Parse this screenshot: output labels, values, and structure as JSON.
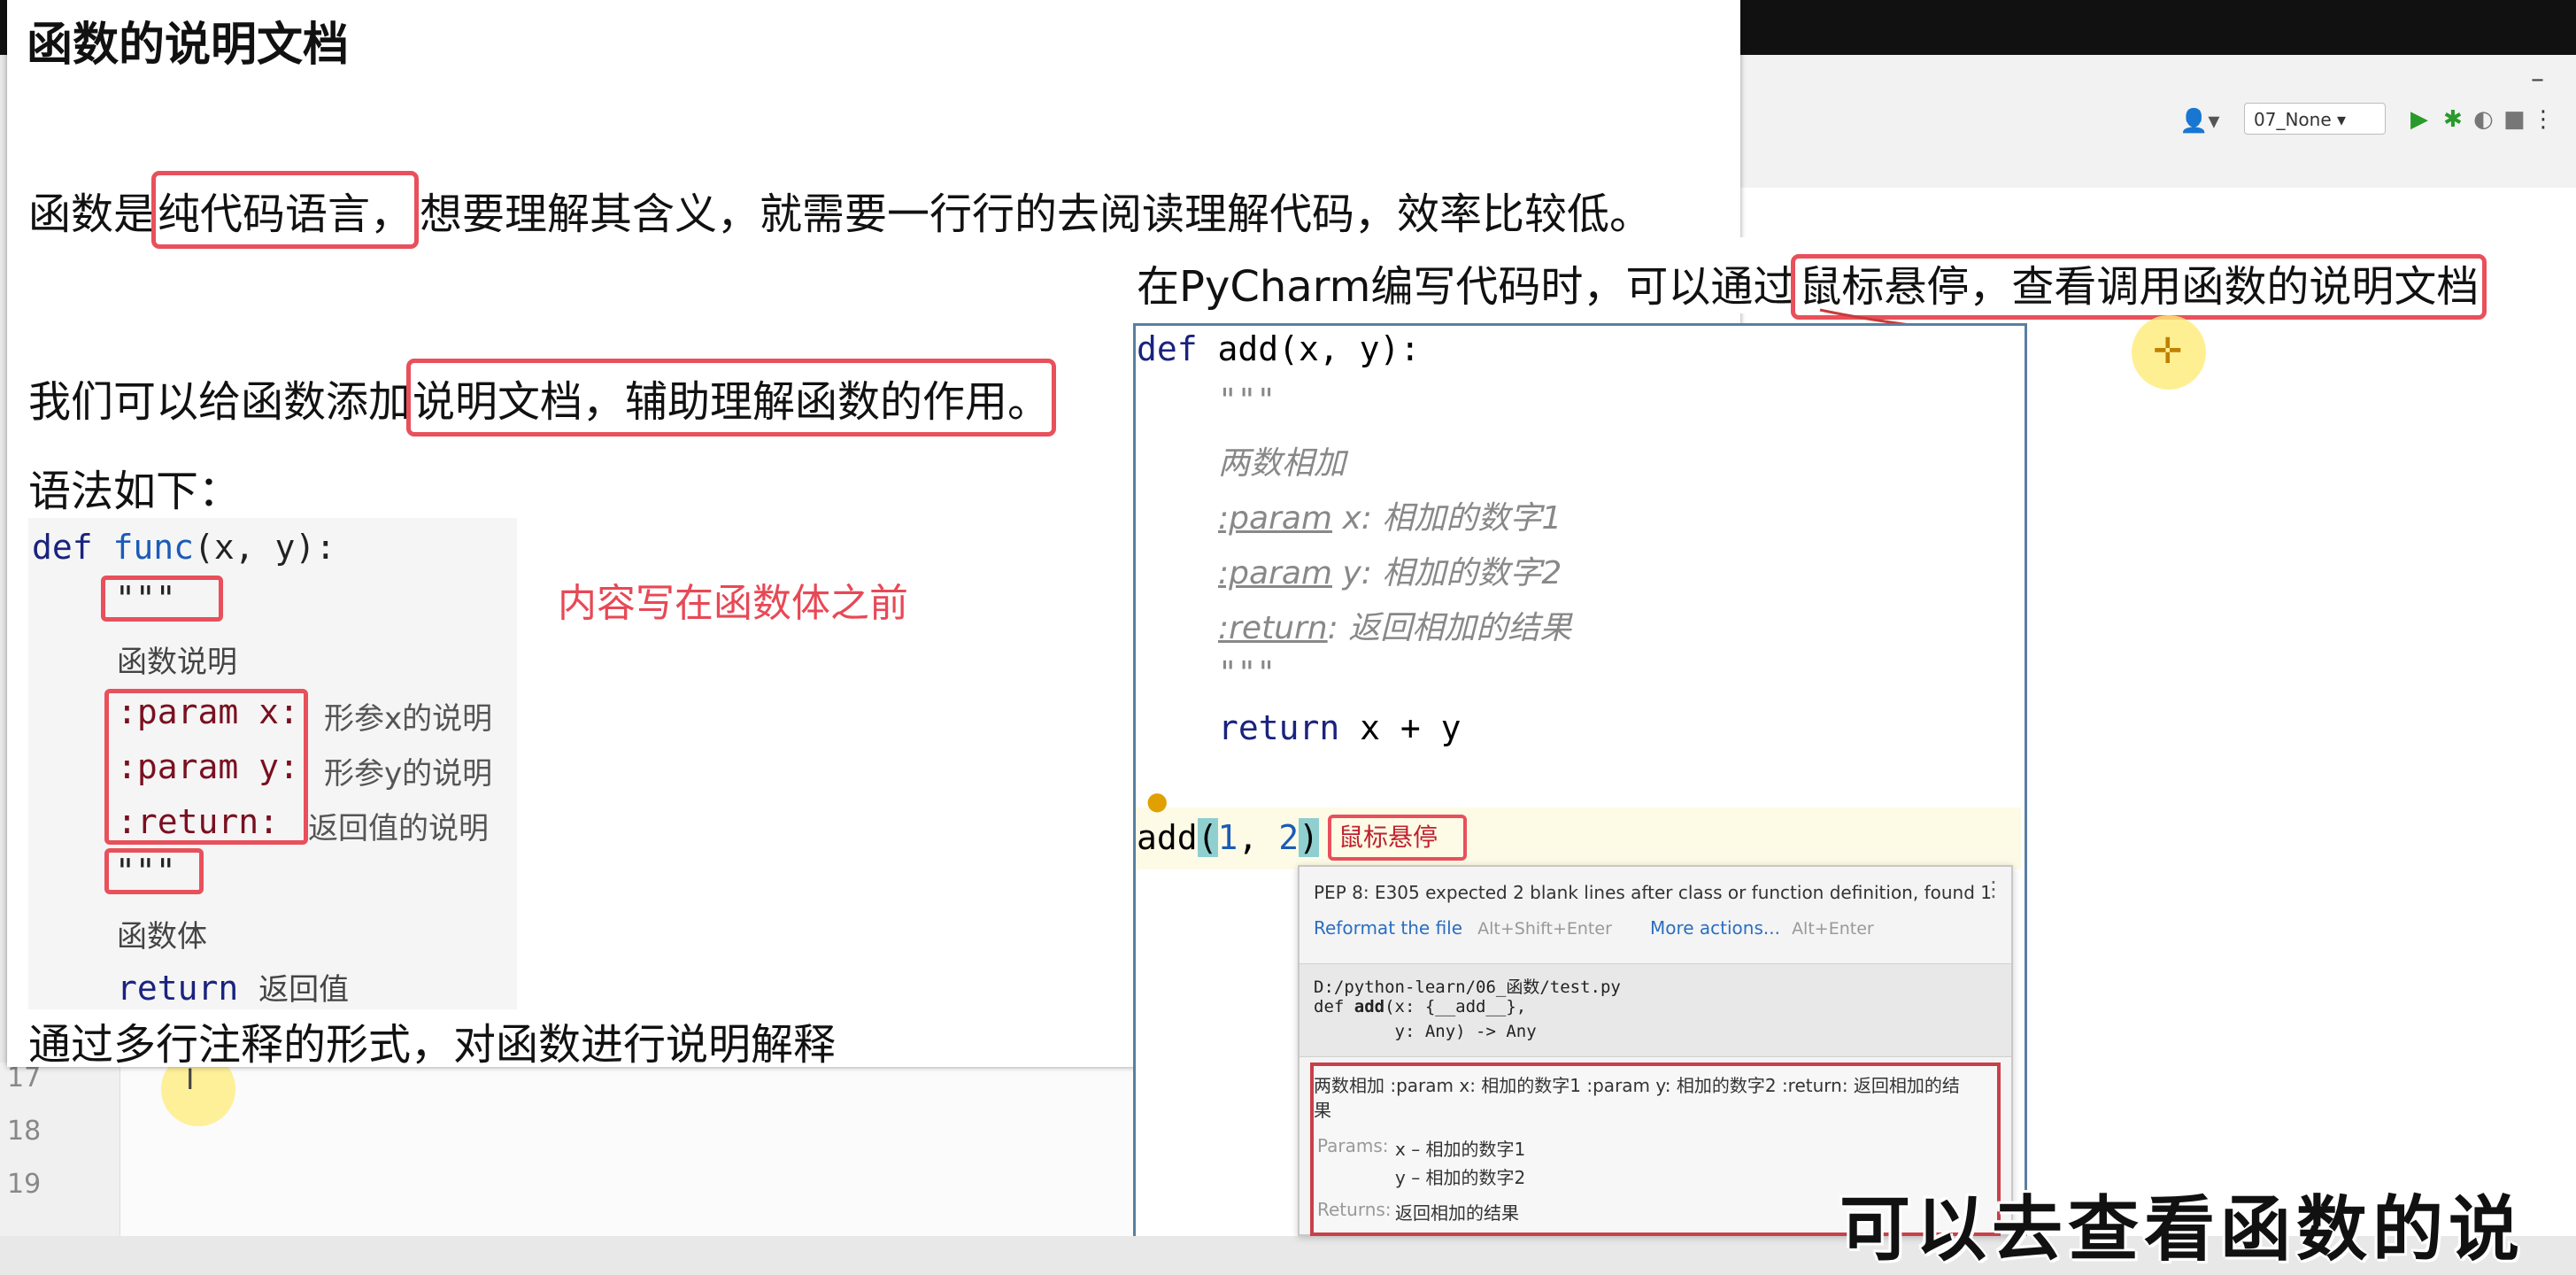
{
  "left_slide": {
    "title": "函数的说明文档",
    "para1": {
      "pre": "函数是",
      "highlight": "纯代码语言，",
      "post": "想要理解其含义，就需要一行行的去阅读理解代码，效率比较低。"
    },
    "para2": {
      "pre": "我们可以给函数添加",
      "highlight": "说明文档，辅助理解函数的作用。"
    },
    "syntax_label": "语法如下：",
    "code": {
      "def_kw": "def",
      "func_name": "func",
      "signature": "(x, y):",
      "triple_quote_open": "\"\"\"",
      "doc_desc": "函数说明",
      "param_x": ":param x:",
      "param_x_desc": "形参x的说明",
      "param_y": ":param y:",
      "param_y_desc": "形参y的说明",
      "return_tag": ":return:",
      "return_desc": "返回值的说明",
      "triple_quote_close": "\"\"\"",
      "body": "函数体",
      "return_kw": "return",
      "return_val": "返回值"
    },
    "note": "内容写在函数体之前",
    "footer": "通过多行注释的形式，对函数进行说明解释"
  },
  "right_slide": {
    "heading_pre": "在PyCharm编写代码时，可以通过",
    "heading_highlight": "鼠标悬停，查看调用函数的说明文档",
    "code": {
      "def_line_kw": "def",
      "def_line_rest": "add(x, y):",
      "q1": "\"\"\"",
      "desc": "两数相加",
      "param_tag": ":param",
      "p1_name": "x:",
      "p1_desc": "相加的数字1",
      "p2_name": "y:",
      "p2_desc": "相加的数字2",
      "return_tag": ":return",
      "return_desc": ": 返回相加的结果",
      "q2": "\"\"\"",
      "return_kw": "return",
      "return_expr": "x + y",
      "call_fn": "add",
      "call_open": "(",
      "call_arg1": "1",
      "call_sep": ", ",
      "call_arg2": "2",
      "call_close": ")"
    },
    "hover_tag": "鼠标悬停"
  },
  "popup": {
    "warning": "PEP 8: E305 expected 2 blank lines after class or function definition, found 1",
    "reformat_link": "Reformat the file",
    "reformat_hint": "Alt+Shift+Enter",
    "more_link": "More actions...",
    "more_hint": "Alt+Enter",
    "path": "D:/python-learn/06_函数/test.py",
    "sig_line1_pre": "def ",
    "sig_line1_name": "add",
    "sig_line1_post": "(x: {__add__},",
    "sig_line2": "        y: Any) -> Any",
    "doc_text_line1": "两数相加 :param x: 相加的数字1 :param y: 相加的数字2 :return: 返回相加的结",
    "doc_text_line2": "果",
    "params_label": "Params:",
    "param1": "x – 相加的数字1",
    "param2": "y – 相加的数字2",
    "returns_label": "Returns:",
    "returns": "返回相加的结果"
  },
  "ide": {
    "run_config": "07_None ▾",
    "line_numbers": [
      "17",
      "18",
      "19"
    ],
    "caret": "I"
  },
  "subtitle": "可以去查看函数的说"
}
